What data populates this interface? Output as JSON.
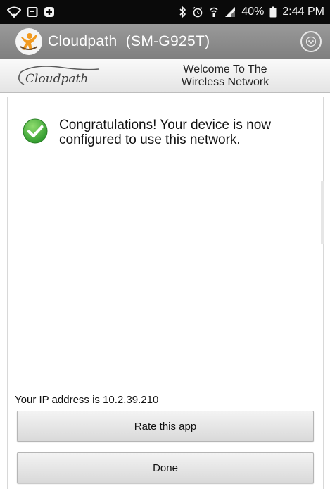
{
  "status_bar": {
    "battery_percent": "40%",
    "time": "2:44 PM",
    "left_icons": [
      "wifi-icon",
      "screen-icon",
      "plus-badge-icon"
    ],
    "right_icons": [
      "bluetooth-icon",
      "alarm-icon",
      "wifi-call-icon",
      "signal-icon",
      "battery-icon"
    ]
  },
  "app_bar": {
    "title": "Cloudpath",
    "device": "(SM-G925T)",
    "logo_icon": "cloudpath-figure-icon",
    "menu_icon": "dropdown-circle-icon"
  },
  "header": {
    "brand": "Cloudpath",
    "title_line1": "Welcome To The",
    "title_line2": "Wireless Network"
  },
  "content": {
    "success_icon": "green-check-icon",
    "success_message": "Congratulations! Your device is now configured to use this network.",
    "ip_text": "Your IP address is 10.2.39.210"
  },
  "buttons": {
    "rate": "Rate this app",
    "done": "Done"
  },
  "colors": {
    "status_bar": "#0a0a0a",
    "app_bar": "#8c8c8c",
    "check_green": "#3fae3b",
    "logo_orange": "#f29a1f"
  }
}
